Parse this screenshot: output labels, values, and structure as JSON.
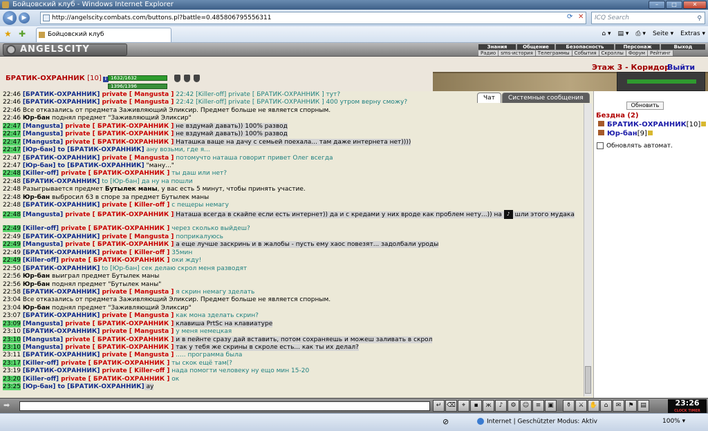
{
  "window": {
    "title": "Бойцовский клуб - Windows Internet Explorer"
  },
  "browser": {
    "url": "http://angelscity.combats.com/buttons.pl?battle=0.485806795556311",
    "search_placeholder": "ICQ Search",
    "tab_title": "Бойцовский клуб",
    "cmd_seite": "Seite ▾",
    "cmd_extras": "Extras ▾"
  },
  "game": {
    "logo": "ANGELSCITY",
    "menu": [
      "Знания",
      "Общение",
      "Безопасность",
      "Персонаж",
      "Выход"
    ],
    "submenu": [
      "Радио",
      "sms-история",
      "Телеграммы",
      "События",
      "Скроллы",
      "Форум",
      "Рейтинг"
    ],
    "char_name": "БРАТИК-ОХРАННИК",
    "char_level": "[10]",
    "hp": "1632/1632",
    "mana": "1396/1396",
    "location": "Этаж 3 - Коридор",
    "exit": "Выйти"
  },
  "chat": {
    "tabs": [
      "Чат",
      "Системные сообщения"
    ],
    "lines": [
      {
        "time": "22:46",
        "g": false,
        "parts": [
          [
            "u",
            "[БРАТИК-ОХРАННИК]"
          ],
          [
            "pr",
            " private [ Mangusta ]"
          ],
          [
            "msg",
            " 22:42 [Killer-off] private [ БРАТИК-ОХРАННИК ] тут?"
          ]
        ]
      },
      {
        "time": "22:46",
        "g": false,
        "parts": [
          [
            "u",
            "[БРАТИК-ОХРАННИК]"
          ],
          [
            "pr",
            " private [ Mangusta ]"
          ],
          [
            "msg",
            " 22:42 [Killer-off] private [ БРАТИК-ОХРАННИК ] 400 утром верну сможу?"
          ]
        ]
      },
      {
        "time": "22:46",
        "g": false,
        "parts": [
          [
            "n",
            "Все отказались от предмета Заживляющий Эликсир. Предмет больше не является спорным."
          ]
        ]
      },
      {
        "time": "22:46",
        "g": false,
        "parts": [
          [
            "b",
            "Юр-бан"
          ],
          [
            "n",
            " поднял предмет \"Заживляющий Эликсир\""
          ]
        ]
      },
      {
        "time": "22:47",
        "g": true,
        "parts": [
          [
            "u",
            "[Mangusta]"
          ],
          [
            "pr",
            " private [ БРАТИК-ОХРАННИК ]"
          ],
          [
            "n",
            " не вздумай давать)) 100% развод"
          ]
        ]
      },
      {
        "time": "22:47",
        "g": true,
        "parts": [
          [
            "u",
            "[Mangusta]"
          ],
          [
            "pr",
            " private [ БРАТИК-ОХРАННИК ]"
          ],
          [
            "n",
            " не вздумай давать)) 100% развод"
          ]
        ]
      },
      {
        "time": "22:47",
        "g": true,
        "parts": [
          [
            "u",
            "[Mangusta]"
          ],
          [
            "pr",
            " private [ БРАТИК-ОХРАННИК ]"
          ],
          [
            "n",
            " Наташка ваще на дачу с семьей поехала... там даже интернета нет))))"
          ]
        ]
      },
      {
        "time": "22:47",
        "g": true,
        "parts": [
          [
            "u",
            "[Юр-бан]"
          ],
          [
            "u",
            " to [БРАТИК-ОХРАННИК]"
          ],
          [
            "msg",
            " ану возьми, где я..."
          ]
        ]
      },
      {
        "time": "22:47",
        "g": false,
        "parts": [
          [
            "u",
            "[БРАТИК-ОХРАННИК]"
          ],
          [
            "pr",
            " private [ Mangusta ]"
          ],
          [
            "msg",
            " потомучто наташа говорит привет Олег всегда"
          ]
        ]
      },
      {
        "time": "22:47",
        "g": false,
        "parts": [
          [
            "u",
            "[Юр-бан]"
          ],
          [
            "u",
            " to [БРАТИК-ОХРАННИК]"
          ],
          [
            "n",
            " \"ману...\""
          ]
        ]
      },
      {
        "time": "22:48",
        "g": true,
        "parts": [
          [
            "u",
            "[Killer-off]"
          ],
          [
            "pr",
            " private [ БРАТИК-ОХРАННИК ]"
          ],
          [
            "msg",
            " ты даш или нет?"
          ]
        ]
      },
      {
        "time": "22:48",
        "g": false,
        "parts": [
          [
            "u",
            "[БРАТИК-ОХРАННИК]"
          ],
          [
            "msg",
            " to [Юр-бан] да ну на пошли"
          ]
        ]
      },
      {
        "time": "22:48",
        "g": false,
        "parts": [
          [
            "n",
            "Разыгрывается предмет "
          ],
          [
            "b",
            "Бутылек маны"
          ],
          [
            "n",
            ", у вас есть 5 минут, чтобы принять участие."
          ]
        ]
      },
      {
        "time": "22:48",
        "g": false,
        "parts": [
          [
            "b",
            "Юр-бан"
          ],
          [
            "n",
            " выбросил 63 в споре за предмет Бутылек маны"
          ]
        ]
      },
      {
        "time": "22:48",
        "g": false,
        "parts": [
          [
            "u",
            "[БРАТИК-ОХРАННИК]"
          ],
          [
            "pr",
            " private [ Killer-off ]"
          ],
          [
            "msg",
            " с пещеры немагу"
          ]
        ]
      },
      {
        "time": "22:48",
        "g": true,
        "wrap": true,
        "parts": [
          [
            "u",
            "[Mangusta]"
          ],
          [
            "pr",
            " private [ БРАТИК-ОХРАННИК ]"
          ],
          [
            "n",
            " Наташа всегда в скайпе если есть интернет)) да и с кредами у них вроде как проблем нету...)) на "
          ],
          [
            "ico",
            "♪"
          ],
          [
            "n",
            " шли этого мудака"
          ]
        ]
      },
      {
        "time": "22:49",
        "g": true,
        "parts": [
          [
            "u",
            "[Killer-off]"
          ],
          [
            "pr",
            " private [ БРАТИК-ОХРАННИК ]"
          ],
          [
            "msg",
            " через сколько выйдеш?"
          ]
        ]
      },
      {
        "time": "22:49",
        "g": false,
        "parts": [
          [
            "u",
            "[БРАТИК-ОХРАННИК]"
          ],
          [
            "pr",
            " private [ Mangusta ]"
          ],
          [
            "msg",
            " поприкалуюсь"
          ]
        ]
      },
      {
        "time": "22:49",
        "g": true,
        "parts": [
          [
            "u",
            "[Mangusta]"
          ],
          [
            "pr",
            " private [ БРАТИК-ОХРАННИК ]"
          ],
          [
            "n",
            " а еще лучше заскринь и в жалобы - пусть ему хаос повезят... задолбали уроды"
          ]
        ]
      },
      {
        "time": "22:49",
        "g": false,
        "parts": [
          [
            "u",
            "[БРАТИК-ОХРАННИК]"
          ],
          [
            "pr",
            " private [ Killer-off ]"
          ],
          [
            "msg",
            " 35мин"
          ]
        ]
      },
      {
        "time": "22:49",
        "g": true,
        "parts": [
          [
            "u",
            "[Killer-off]"
          ],
          [
            "pr",
            " private [ БРАТИК-ОХРАННИК ]"
          ],
          [
            "msg",
            " оки жду!"
          ]
        ]
      },
      {
        "time": "22:50",
        "g": false,
        "parts": [
          [
            "u",
            "[БРАТИК-ОХРАННИК]"
          ],
          [
            "msg",
            " to [Юр-бан] сек делаю скрол меня разводят"
          ]
        ]
      },
      {
        "time": "22:56",
        "g": false,
        "parts": [
          [
            "b",
            "Юр-бан"
          ],
          [
            "n",
            " выиграл предмет Бутылек маны"
          ]
        ]
      },
      {
        "time": "22:56",
        "g": false,
        "parts": [
          [
            "b",
            "Юр-бан"
          ],
          [
            "n",
            " поднял предмет \"Бутылек маны\""
          ]
        ]
      },
      {
        "time": "22:58",
        "g": false,
        "parts": [
          [
            "u",
            "[БРАТИК-ОХРАННИК]"
          ],
          [
            "pr",
            " private [ Mangusta ]"
          ],
          [
            "msg",
            " я скрин немагу зделать"
          ]
        ]
      },
      {
        "time": "23:04",
        "g": false,
        "parts": [
          [
            "n",
            "Все отказались от предмета Заживляющий Эликсир. Предмет больше не является спорным."
          ]
        ]
      },
      {
        "time": "23:04",
        "g": false,
        "parts": [
          [
            "b",
            "Юр-бан"
          ],
          [
            "n",
            " поднял предмет \"Заживляющий Эликсир\""
          ]
        ]
      },
      {
        "time": "23:07",
        "g": false,
        "parts": [
          [
            "u",
            "[БРАТИК-ОХРАННИК]"
          ],
          [
            "pr",
            " private [ Mangusta ]"
          ],
          [
            "msg",
            " как мона зделать скрин?"
          ]
        ]
      },
      {
        "time": "23:09",
        "g": true,
        "parts": [
          [
            "u",
            "[Mangusta]"
          ],
          [
            "pr",
            " private [ БРАТИК-ОХРАННИК ]"
          ],
          [
            "n",
            " клавиша PrtSc на клавиатуре"
          ]
        ]
      },
      {
        "time": "23:10",
        "g": false,
        "parts": [
          [
            "u",
            "[БРАТИК-ОХРАННИК]"
          ],
          [
            "pr",
            " private [ Mangusta ]"
          ],
          [
            "msg",
            " у меня немецкая"
          ]
        ]
      },
      {
        "time": "23:10",
        "g": true,
        "parts": [
          [
            "u",
            "[Mangusta]"
          ],
          [
            "pr",
            " private [ БРАТИК-ОХРАННИК ]"
          ],
          [
            "n",
            " и в пейнте сразу дай вставить, потом сохраняешь и можеш заливать в скрол"
          ]
        ]
      },
      {
        "time": "23:10",
        "g": true,
        "parts": [
          [
            "u",
            "[Mangusta]"
          ],
          [
            "pr",
            " private [ БРАТИК-ОХРАННИК ]"
          ],
          [
            "n",
            " так у тебя же скрины в скроле есть... как ты их делал?"
          ]
        ]
      },
      {
        "time": "23:11",
        "g": false,
        "parts": [
          [
            "u",
            "[БРАТИК-ОХРАННИК]"
          ],
          [
            "pr",
            " private [ Mangusta ]"
          ],
          [
            "msg",
            " ..... программа была"
          ]
        ]
      },
      {
        "time": "23:17",
        "g": true,
        "parts": [
          [
            "u",
            "[Killer-off]"
          ],
          [
            "pr",
            " private [ БРАТИК-ОХРАННИК ]"
          ],
          [
            "msg",
            " ты скок ещё там(?"
          ]
        ]
      },
      {
        "time": "23:19",
        "g": false,
        "parts": [
          [
            "u",
            "[БРАТИК-ОХРАННИК]"
          ],
          [
            "pr",
            " private [ Killer-off ]"
          ],
          [
            "msg",
            " нада помогти человеку ну ещо мин 15-20"
          ]
        ]
      },
      {
        "time": "23:20",
        "g": true,
        "parts": [
          [
            "u",
            "[Killer-off]"
          ],
          [
            "pr",
            " private [ БРАТИК-ОХРАННИК ]"
          ],
          [
            "msg",
            " ок"
          ]
        ]
      },
      {
        "time": "23:25",
        "g": true,
        "parts": [
          [
            "u",
            "[Юр-бан]"
          ],
          [
            "u",
            " to [БРАТИК-ОХРАННИК]"
          ],
          [
            "n",
            " ау"
          ]
        ]
      }
    ]
  },
  "room": {
    "refresh_label": "Обновить",
    "title": "Бездна (2)",
    "players": [
      {
        "name": "БРАТИК-ОХРАННИК",
        "level": "[10]"
      },
      {
        "name": "Юр-бан",
        "level": "[9]"
      }
    ],
    "auto_refresh_label": "Обновлять автомат."
  },
  "clock": {
    "time": "23:26",
    "label": "CLOCK TIMER"
  },
  "status": {
    "zone": "Internet | Geschützter Modus: Aktiv",
    "zoom": "100% ▾"
  }
}
